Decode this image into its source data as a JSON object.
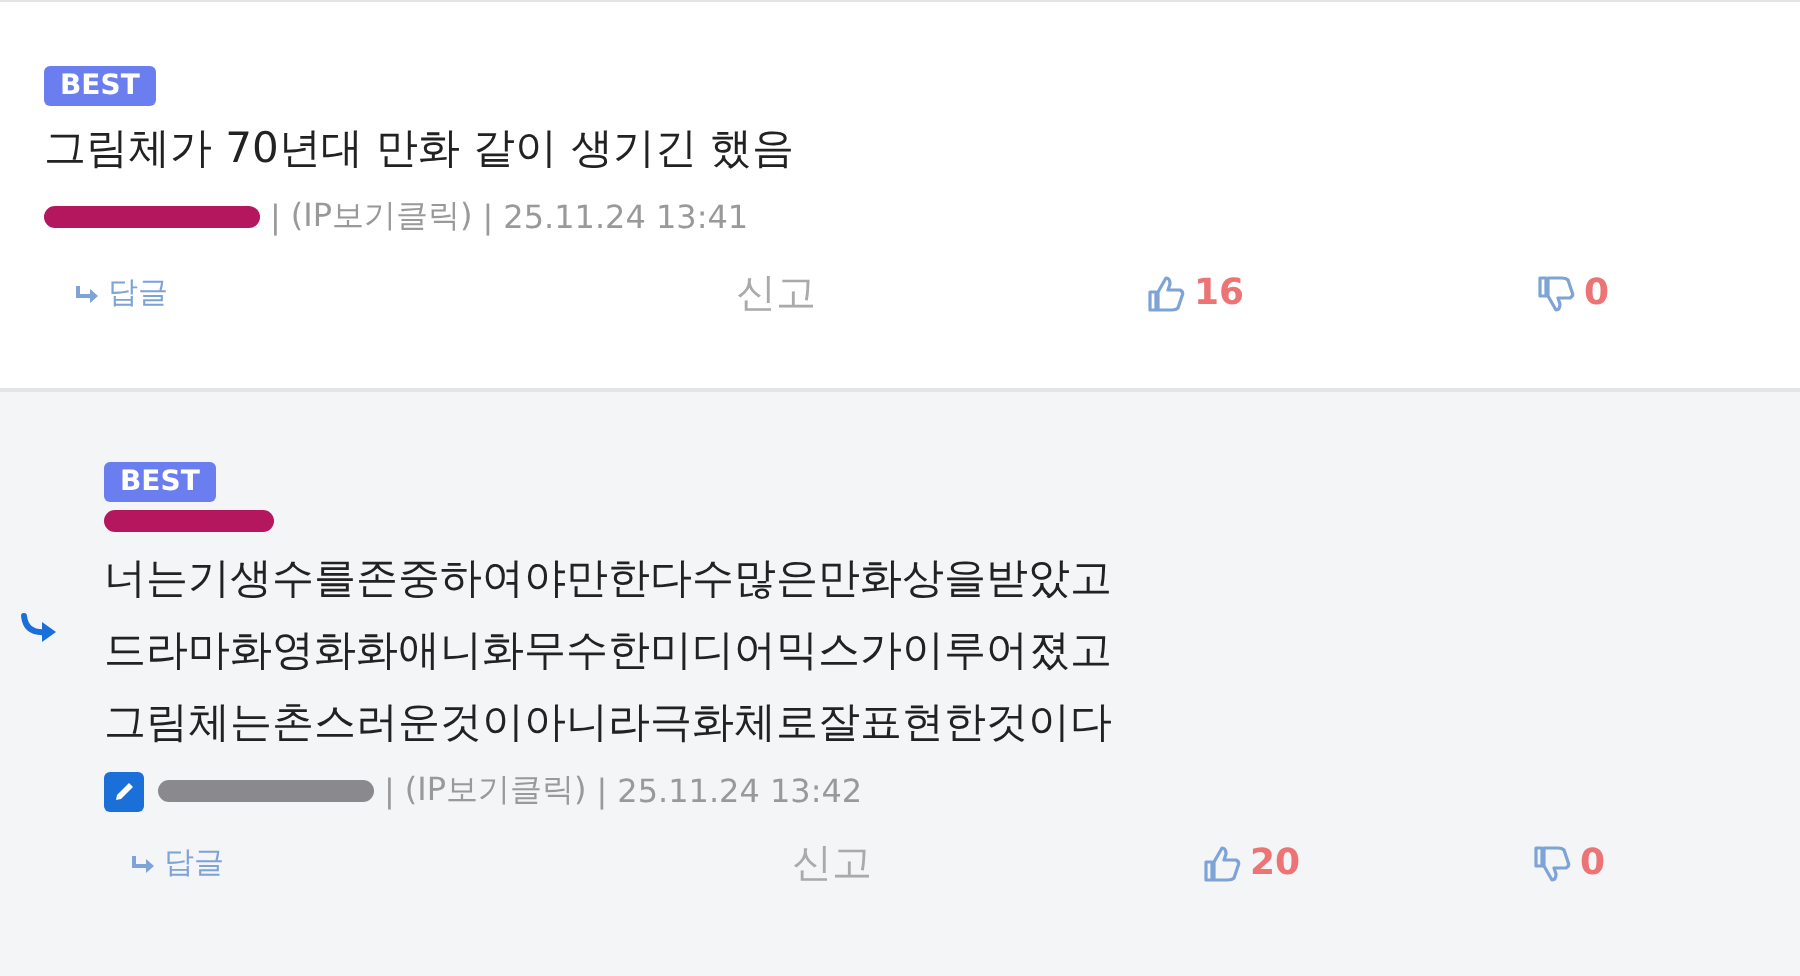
{
  "comments": [
    {
      "is_reply": false,
      "best": "BEST",
      "name_line": false,
      "text_lines": [
        "그림체가 70년대 만화 같이 생기긴 했음"
      ],
      "author": {
        "color": "#b5175e",
        "editor_icon": false
      },
      "separator": "|",
      "ip": "(IP보기클릭)",
      "date": "25.11.24 13:41",
      "reply_label": "답글",
      "report_label": "신고",
      "likes": "16",
      "dislikes": "0"
    },
    {
      "is_reply": true,
      "best": "BEST",
      "name_line": true,
      "text_lines": [
        "너는기생수를존중하여야만한다수많은만화상을받았고",
        "드라마화영화화애니화무수한미디어믹스가이루어졌고",
        "그림체는촌스러운것이아니라극화체로잘표현한것이다"
      ],
      "author": {
        "color": "#8a8a8e",
        "editor_icon": true
      },
      "separator": "|",
      "ip": "(IP보기클릭)",
      "date": "25.11.24 13:42",
      "reply_label": "답글",
      "report_label": "신고",
      "likes": "20",
      "dislikes": "0"
    }
  ]
}
